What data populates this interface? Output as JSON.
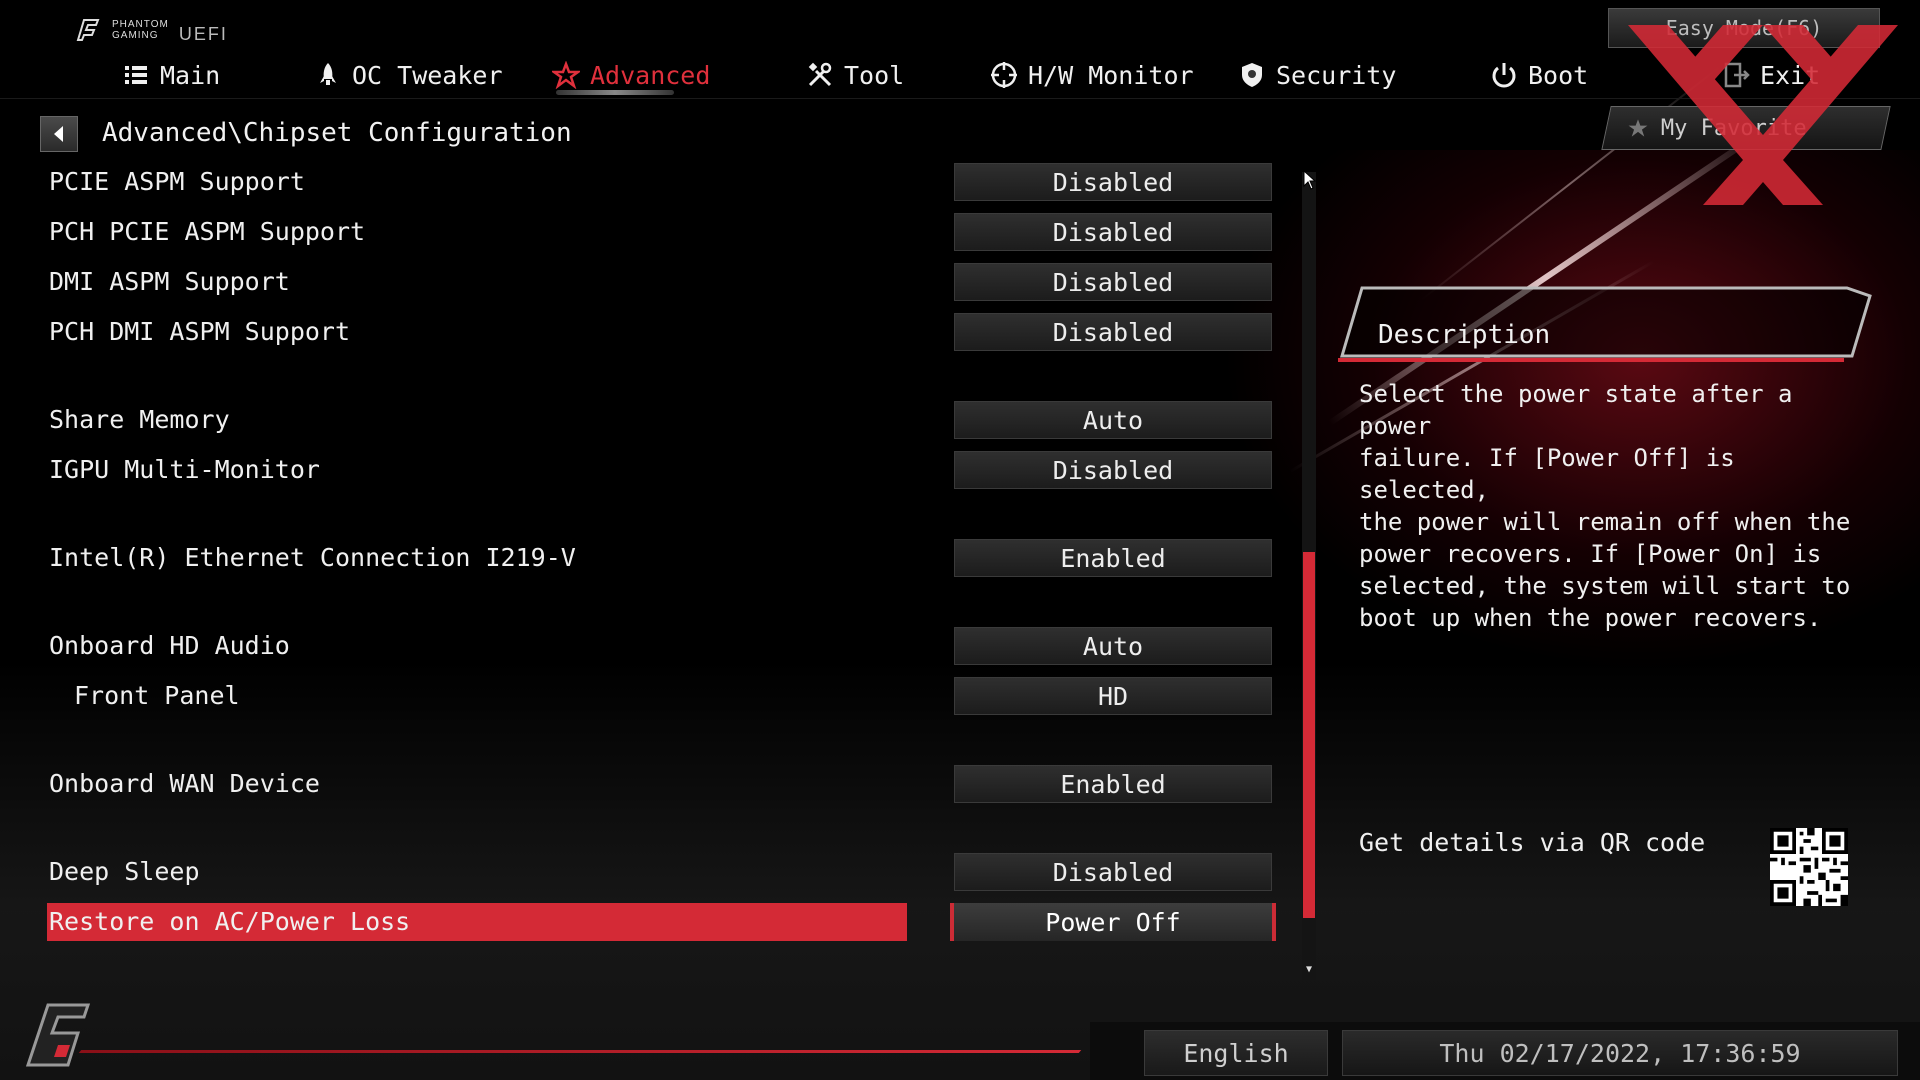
{
  "header": {
    "logo_line1": "PHANTOM",
    "logo_line2": "GAMING",
    "logo_uefi": "UEFI",
    "easy_mode_label": "Easy Mode(F6)",
    "my_favorite_label": "My Favorite"
  },
  "nav": [
    {
      "label": "Main",
      "icon": "list-icon",
      "active": false
    },
    {
      "label": "OC Tweaker",
      "icon": "rocket-icon",
      "active": false
    },
    {
      "label": "Advanced",
      "icon": "star-icon",
      "active": true
    },
    {
      "label": "Tool",
      "icon": "tools-icon",
      "active": false
    },
    {
      "label": "H/W Monitor",
      "icon": "crosshair-icon",
      "active": false
    },
    {
      "label": "Security",
      "icon": "shield-icon",
      "active": false
    },
    {
      "label": "Boot",
      "icon": "power-icon",
      "active": false
    },
    {
      "label": "Exit",
      "icon": "exit-icon",
      "active": false
    }
  ],
  "breadcrumb": "Advanced\\Chipset Configuration",
  "settings": [
    {
      "label": "PCIE ASPM Support",
      "value": "Disabled"
    },
    {
      "label": "PCH PCIE ASPM Support",
      "value": "Disabled"
    },
    {
      "label": "DMI ASPM Support",
      "value": "Disabled"
    },
    {
      "label": "PCH DMI ASPM Support",
      "value": "Disabled"
    },
    {
      "label": "Share Memory",
      "value": "Auto"
    },
    {
      "label": "IGPU Multi-Monitor",
      "value": "Disabled"
    },
    {
      "label": "Intel(R) Ethernet Connection I219-V",
      "value": "Enabled"
    },
    {
      "label": "Onboard HD Audio",
      "value": "Auto"
    },
    {
      "label": "Front Panel",
      "value": "HD"
    },
    {
      "label": "Onboard WAN Device",
      "value": "Enabled"
    },
    {
      "label": "Deep Sleep",
      "value": "Disabled"
    },
    {
      "label": "Restore on AC/Power Loss",
      "value": "Power Off",
      "selected": true
    }
  ],
  "description": {
    "title": "Description",
    "text": "Select the power state after a power\nfailure. If [Power Off] is selected,\nthe power will remain off when the\npower recovers. If [Power On] is\nselected, the system will start to\nboot up when the power recovers.",
    "qr_label": "Get details via QR code"
  },
  "footer": {
    "language": "English",
    "datetime": "Thu 02/17/2022, 17:36:59"
  },
  "colors": {
    "accent": "#d42a36",
    "background": "#000000",
    "text": "#f0f0f0"
  }
}
